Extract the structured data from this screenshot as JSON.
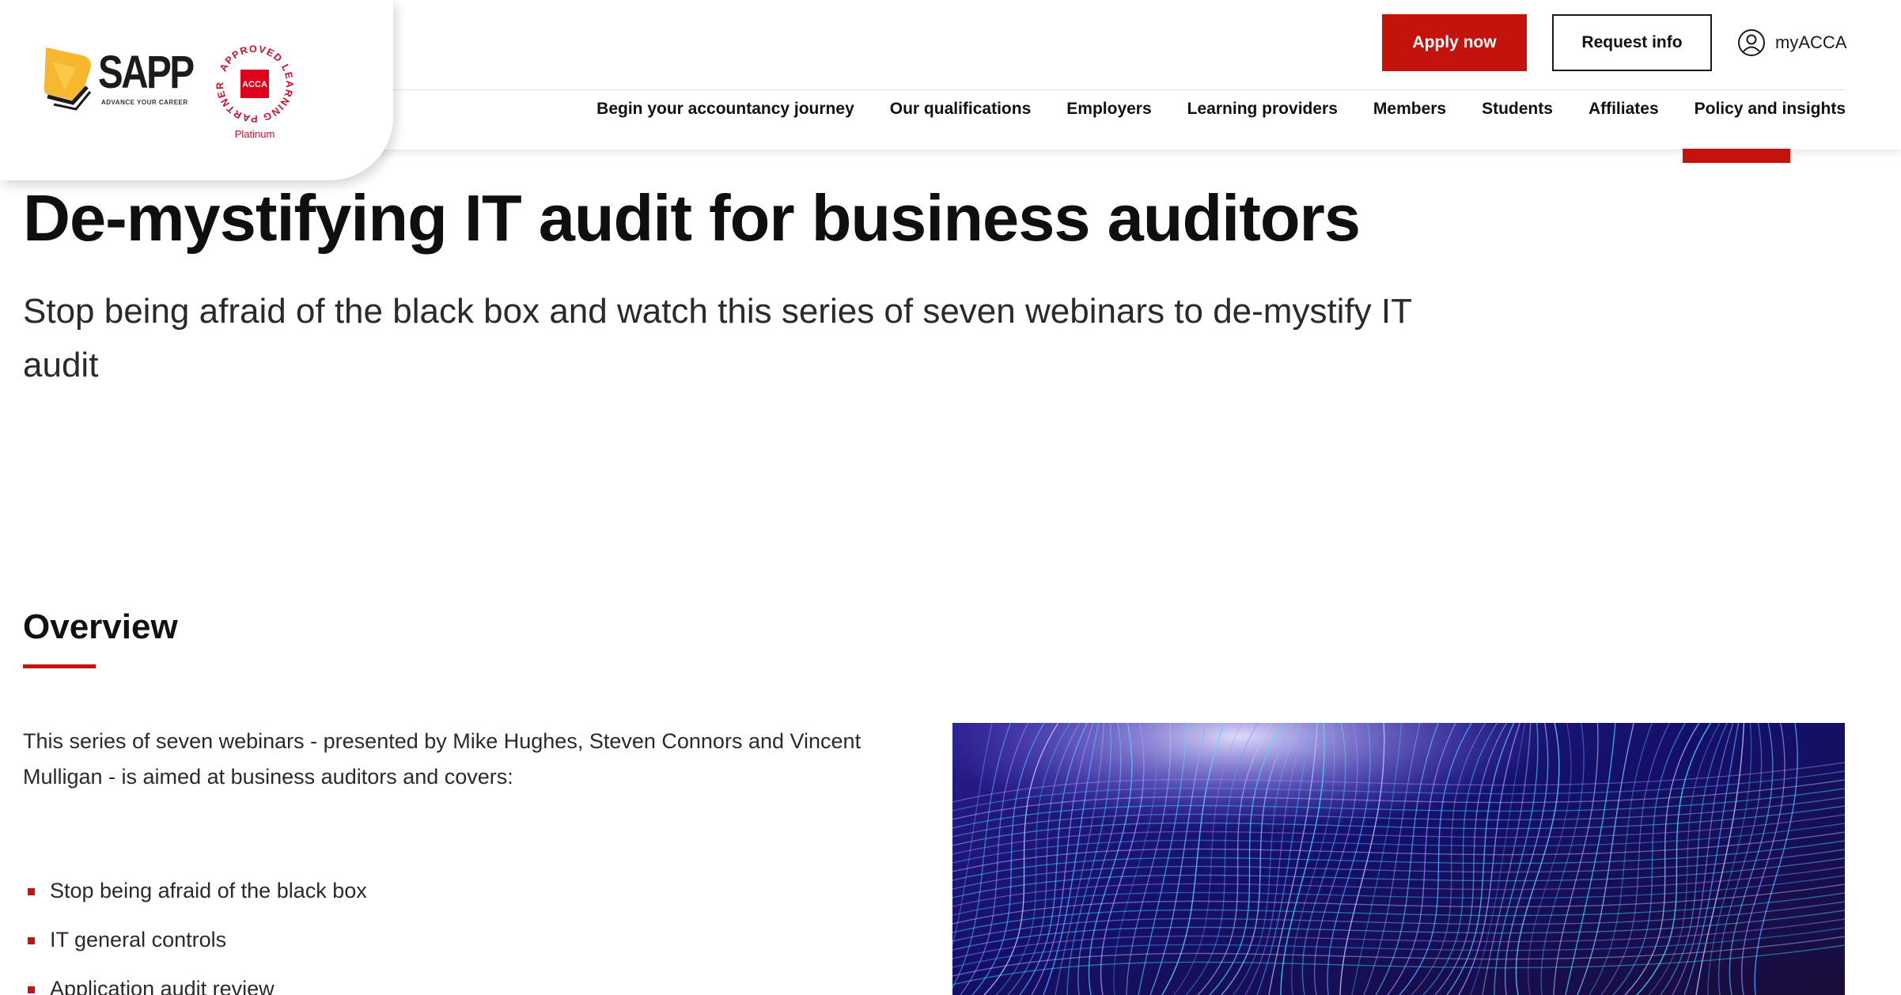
{
  "branding": {
    "logo_name": "SAPP",
    "logo_tagline": "ADVANCE YOUR CAREER",
    "badge_arc_text": "APPROVED LEARNING PARTNER",
    "badge_center": "ACCA",
    "badge_tier": "Platinum"
  },
  "header": {
    "apply_label": "Apply now",
    "request_label": "Request info",
    "account_label": "myACCA",
    "nav": [
      "Begin your accountancy journey",
      "Our qualifications",
      "Employers",
      "Learning providers",
      "Members",
      "Students",
      "Affiliates",
      "Policy and insights"
    ]
  },
  "page": {
    "title": "De-mystifying IT audit for business auditors",
    "subtitle": "Stop being afraid of the black box and watch this series of seven webinars to de-mystify IT audit"
  },
  "overview": {
    "heading": "Overview",
    "intro": "This series of seven webinars - presented by Mike Hughes, Steven Connors and Vincent Mulligan - is aimed at business auditors and covers:",
    "bullets": [
      "Stop being afraid of the black box",
      "IT general controls",
      "Application audit review"
    ]
  },
  "colors": {
    "brand_red": "#c4120c",
    "sapp_yellow": "#f5b82e",
    "text_dark": "#1a1a1a"
  },
  "icons": {
    "account": "user-circle-icon",
    "bullet": "square-bullet-icon"
  }
}
